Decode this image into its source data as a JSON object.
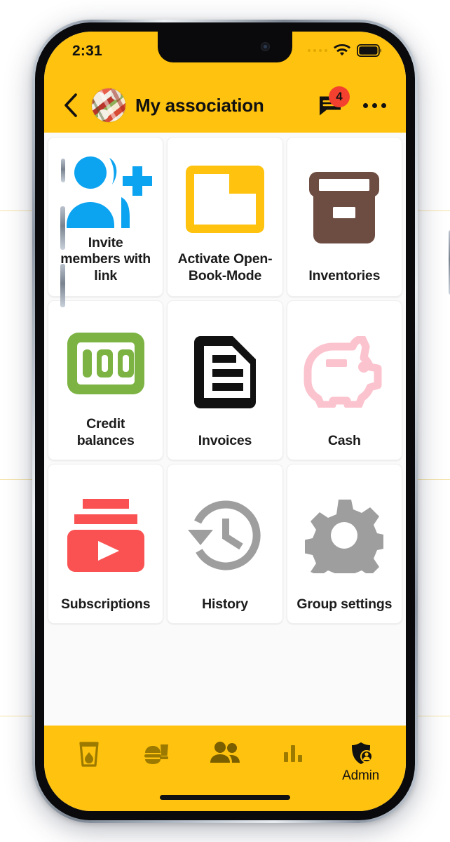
{
  "status_bar": {
    "time": "2:31",
    "signal_icon": "signal-dots-icon",
    "wifi_icon": "wifi-icon",
    "battery_icon": "battery-full-icon"
  },
  "app_bar": {
    "back_icon": "chevron-left-icon",
    "avatar_icon": "group-avatar-photo",
    "title": "My association",
    "chat_icon": "chat-bubble-icon",
    "chat_badge_count": "4",
    "overflow_icon": "more-horizontal-icon"
  },
  "theme": {
    "accent_yellow": "#FFC20E",
    "badge_red": "#F4402E",
    "page_background": "#FAFAFA",
    "card_background": "#FFFFFF",
    "text_primary": "#1B1B1B"
  },
  "grid": {
    "tiles": [
      {
        "label": "Invite\nmembers with\nlink",
        "icon": "person-add-icon",
        "color": "#0CA3F0"
      },
      {
        "label": "Activate Open-\nBook-Mode",
        "icon": "folder-open-icon",
        "color": "#FFC20E"
      },
      {
        "label": "Inventories",
        "icon": "archive-box-icon",
        "color": "#6D4C41"
      },
      {
        "label": "Credit\nbalances",
        "icon": "banknote-100-icon",
        "color": "#7CB342"
      },
      {
        "label": "Invoices",
        "icon": "document-lines-icon",
        "color": "#111111"
      },
      {
        "label": "Cash",
        "icon": "piggy-bank-icon",
        "color": "#FBC3CE"
      },
      {
        "label": "Subscriptions",
        "icon": "subscriptions-play-icon",
        "color": "#FA5252"
      },
      {
        "label": "History",
        "icon": "history-clock-icon",
        "color": "#9E9E9E"
      },
      {
        "label": "Group settings",
        "icon": "gear-icon",
        "color": "#9E9E9E"
      }
    ]
  },
  "bottom_nav": {
    "items": [
      {
        "label": "",
        "icon": "drink-cup-icon",
        "active": false
      },
      {
        "label": "",
        "icon": "food-meal-icon",
        "active": false
      },
      {
        "label": "",
        "icon": "people-icon",
        "active": false
      },
      {
        "label": "",
        "icon": "bar-chart-icon",
        "active": false
      },
      {
        "label": "Admin",
        "icon": "shield-admin-icon",
        "active": true
      }
    ]
  }
}
